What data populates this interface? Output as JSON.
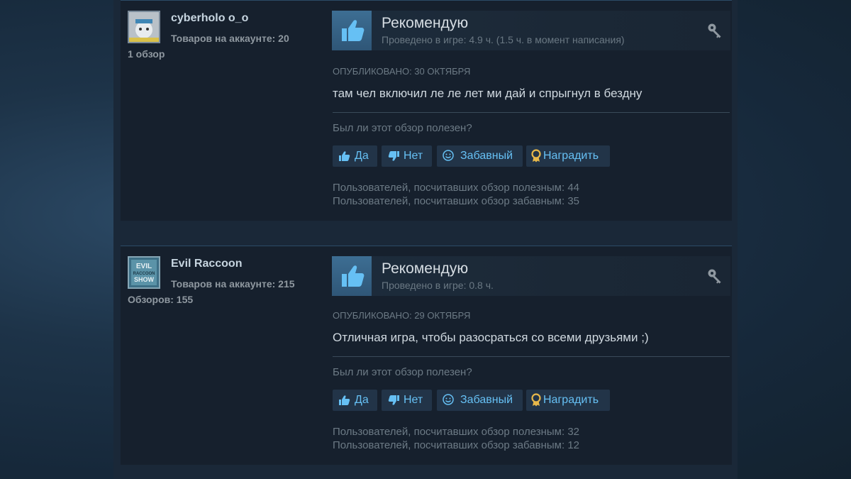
{
  "reviews": [
    {
      "author": {
        "name": "cyberholo o_o",
        "products_owned": "Товаров на аккаунте: 20",
        "reviews_count": "1 обзор"
      },
      "verdict": "Рекомендую",
      "hours": "Проведено в игре: 4.9 ч. (1.5 ч. в момент написания)",
      "posted": "ОПУБЛИКОВАНО: 30 ОКТЯБРЯ",
      "text": "там чел включил ле ле лет ми дай и спрыгнул в бездну",
      "helpful_question": "Был ли этот обзор полезен?",
      "buttons": {
        "yes": "Да",
        "no": "Нет",
        "funny": "Забавный",
        "award": "Наградить"
      },
      "helpful_stat": "Пользователей, посчитавших обзор полезным: 44",
      "funny_stat": "Пользователей, посчитавших обзор забавным: 35"
    },
    {
      "author": {
        "name": "Evil Raccoon",
        "products_owned": "Товаров на аккаунте: 215",
        "reviews_count": "Обзоров: 155",
        "avatar_text": [
          "EVIL",
          "RACCOON",
          "SHOW"
        ]
      },
      "verdict": "Рекомендую",
      "hours": "Проведено в игре: 0.8 ч.",
      "posted": "ОПУБЛИКОВАНО: 29 ОКТЯБРЯ",
      "text": "Отличная игра, чтобы разосраться со всеми друзьями ;)",
      "helpful_question": "Был ли этот обзор полезен?",
      "buttons": {
        "yes": "Да",
        "no": "Нет",
        "funny": "Забавный",
        "award": "Наградить"
      },
      "helpful_stat": "Пользователей, посчитавших обзор полезным: 32",
      "funny_stat": "Пользователей, посчитавших обзор забавным: 12"
    }
  ],
  "colors": {
    "accent_link": "#66c0f4",
    "thumb_blue": "#3d6e93",
    "award_gold": "#e8b84a"
  },
  "icons": [
    "thumbs-up-icon",
    "thumbs-down-icon",
    "smiley-icon",
    "award-ribbon-icon",
    "key-icon"
  ]
}
